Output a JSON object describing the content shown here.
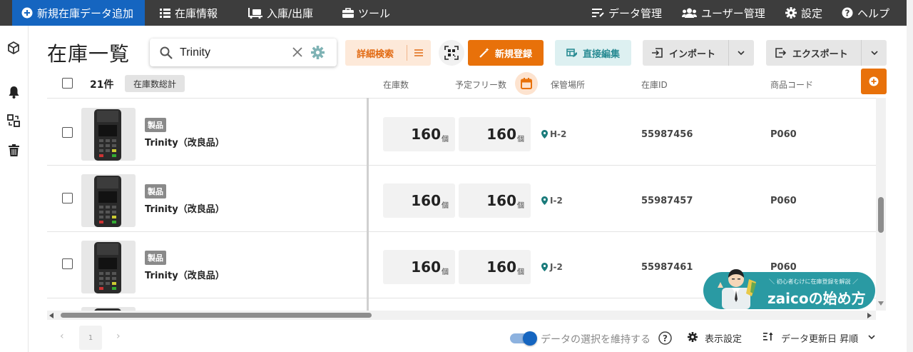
{
  "topbar": {
    "new_button": "新規在庫データ追加",
    "stock_info": "在庫情報",
    "in_out": "入庫/出庫",
    "tools": "ツール",
    "data_management": "データ管理",
    "user_management": "ユーザー管理",
    "settings": "設定",
    "help": "ヘルプ"
  },
  "page": {
    "title": "在庫一覧"
  },
  "search": {
    "value": "Trinity"
  },
  "toolbar": {
    "advanced_search": "詳細検索",
    "new_register": "新規登録",
    "direct_edit": "直接編集",
    "import": "インポート",
    "export": "エクスポート"
  },
  "list_header": {
    "count": "21件",
    "total_button": "在庫数総計",
    "col_quantity": "在庫数",
    "col_free": "予定フリー数",
    "col_location": "保管場所",
    "col_stock_id": "在庫ID",
    "col_product_code": "商品コード"
  },
  "rows": [
    {
      "category": "製品",
      "name": "Trinity（改良品）",
      "quantity": "160",
      "free": "160",
      "unit": "個",
      "location": "H-2",
      "stock_id": "55987456",
      "product_code": "P060"
    },
    {
      "category": "製品",
      "name": "Trinity（改良品）",
      "quantity": "160",
      "free": "160",
      "unit": "個",
      "location": "I-2",
      "stock_id": "55987457",
      "product_code": "P060"
    },
    {
      "category": "製品",
      "name": "Trinity（改良品）",
      "quantity": "160",
      "free": "160",
      "unit": "個",
      "location": "J-2",
      "stock_id": "55987461",
      "product_code": "P060"
    }
  ],
  "pagination": {
    "prev": "‹",
    "page": "1",
    "next": "›"
  },
  "footer": {
    "keep_selection": "データの選択を維持する",
    "display_settings": "表示設定",
    "sort": "データ更新日 昇順"
  },
  "banner": {
    "subtitle": "＼ 初心者むけに在庫登録を解説 ／",
    "title": "zaicoの始め方"
  },
  "colors": {
    "topbar": "#3d3d3d",
    "active_nav": "#1565c0",
    "accent_orange": "#e8710a",
    "teal": "#2a9aa3",
    "location_pin": "#1a7b7b"
  },
  "icons": {
    "box": "box-icon",
    "bell": "bell-icon",
    "merge": "merge-icon",
    "trash": "trash-icon",
    "qr": "qr-code-icon",
    "calendar": "calendar-icon",
    "plus": "plus-circle-icon"
  }
}
